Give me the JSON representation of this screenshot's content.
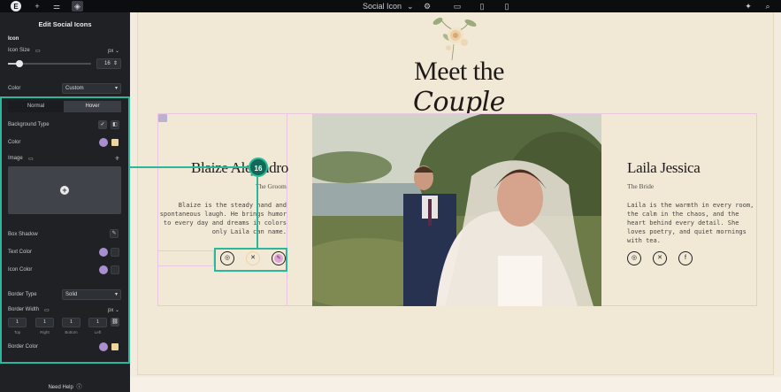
{
  "topbar": {
    "page_name": "Social Icon",
    "page_caret": "⌄",
    "icons": [
      "elementor-logo-icon",
      "add-icon",
      "sliders-icon",
      "layers-icon",
      "gear-icon",
      "desktop-icon",
      "tablet-icon",
      "mobile-icon",
      "share-icon",
      "search-icon"
    ]
  },
  "sidebar": {
    "title": "Edit Social Icons",
    "section": "Icon",
    "icon_size_label": "Icon Size",
    "icon_size_unit": "px ⌄",
    "icon_size_value": "16",
    "icon_size_fraction": 0.14,
    "color_label": "Color",
    "color_value": "Custom",
    "tabs": {
      "normal": "Normal",
      "hover": "Hover"
    },
    "background_type_label": "Background Type",
    "color2_label": "Color",
    "image_label": "Image",
    "box_shadow_label": "Box Shadow",
    "text_color_label": "Text Color",
    "icon_color_label": "Icon Color",
    "border_type_label": "Border Type",
    "border_type_value": "Solid",
    "border_width_label": "Border Width",
    "border_width_unit": "px ⌄",
    "border_values": [
      "1",
      "1",
      "1",
      "1"
    ],
    "border_sides": [
      "Top",
      "Right",
      "Bottom",
      "Left"
    ],
    "border_color_label": "Border Color",
    "need_help": "Need Help",
    "swatch_color": "#f0d59a"
  },
  "canvas": {
    "heading_plain": "Meet the ",
    "heading_script": "Couple",
    "groom": {
      "name": "Blaize Alejandro",
      "role": "The Groom",
      "bio": "Blaize is the steady hand and spontaneous laugh. He brings humor to every day and dreams in colors only Laila can name."
    },
    "bride": {
      "name": "Laila Jessica",
      "role": "The Bride",
      "bio": "Laila is the warmth in every room, the calm in the chaos, and the heart behind every detail. She loves poetry, and quiet mornings with tea."
    },
    "size_badge": "16",
    "social_glyphs": {
      "instagram": "◎",
      "x": "✕",
      "facebook": "f"
    }
  },
  "colors": {
    "accent": "#2bb89a",
    "canvas_bg": "#f1e8d6",
    "sidebar_bg": "#1f2124",
    "hover_icon_bg": "#f0d59a"
  }
}
